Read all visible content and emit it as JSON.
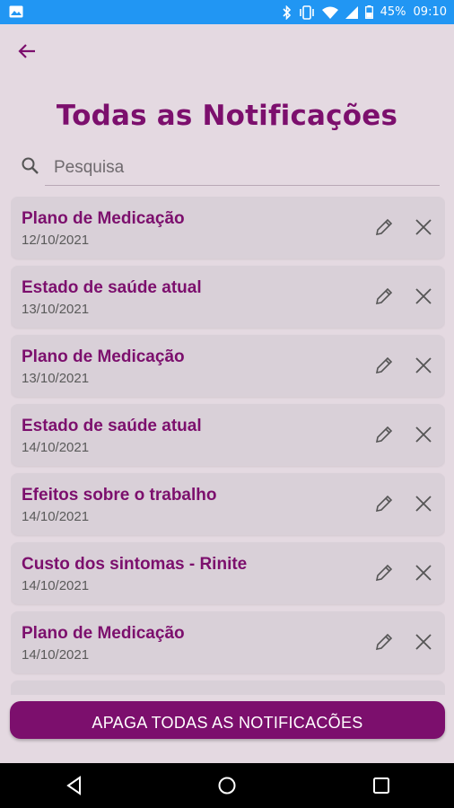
{
  "status_bar": {
    "battery": "45%",
    "time": "09:10"
  },
  "header": {
    "title": "Todas as Notificações"
  },
  "search": {
    "placeholder": "Pesquisa"
  },
  "notifications": [
    {
      "title": "Plano de Medicação",
      "date": "12/10/2021"
    },
    {
      "title": "Estado de saúde atual",
      "date": "13/10/2021"
    },
    {
      "title": "Plano de Medicação",
      "date": "13/10/2021"
    },
    {
      "title": "Estado de saúde atual",
      "date": "14/10/2021"
    },
    {
      "title": "Efeitos sobre o trabalho",
      "date": "14/10/2021"
    },
    {
      "title": "Custo dos sintomas - Rinite",
      "date": "14/10/2021"
    },
    {
      "title": "Plano de Medicação",
      "date": "14/10/2021"
    }
  ],
  "actions": {
    "delete_all": "APAGA TODAS AS NOTIFICACÕES"
  },
  "colors": {
    "accent": "#7c0f6d",
    "background": "#e4d9e1",
    "card": "#d9d0d8",
    "status_bar": "#2196f3"
  },
  "icons": [
    "image-icon",
    "bluetooth-icon",
    "vibrate-icon",
    "wifi-icon",
    "signal-icon",
    "battery-icon",
    "back-arrow-icon",
    "search-icon",
    "edit-icon",
    "close-icon",
    "nav-back-icon",
    "nav-home-icon",
    "nav-recents-icon"
  ]
}
